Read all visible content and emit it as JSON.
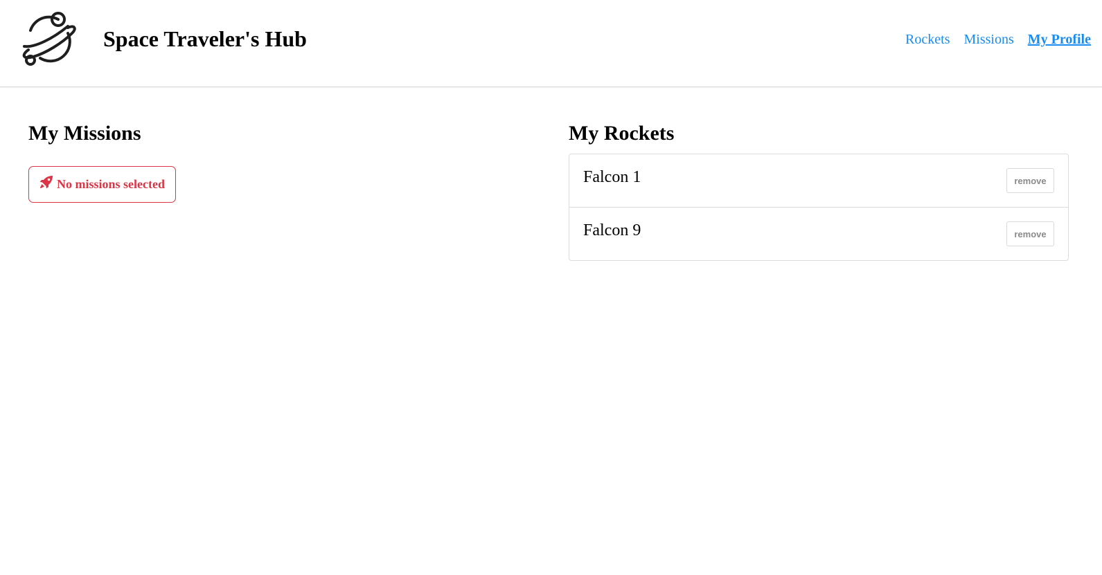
{
  "header": {
    "logo_icon": "planet-icon",
    "title": "Space Traveler's Hub",
    "nav": [
      {
        "label": "Rockets",
        "active": false
      },
      {
        "label": "Missions",
        "active": false
      },
      {
        "label": "My Profile",
        "active": true
      }
    ],
    "link_color": "#1a8cf0"
  },
  "missions": {
    "title": "My Missions",
    "empty_icon": "rocket-icon",
    "empty_message": "No missions selected",
    "alert_color": "#dc3545"
  },
  "rockets": {
    "title": "My Rockets",
    "items": [
      {
        "name": "Falcon 1",
        "action_label": "remove"
      },
      {
        "name": "Falcon 9",
        "action_label": "remove"
      }
    ]
  }
}
